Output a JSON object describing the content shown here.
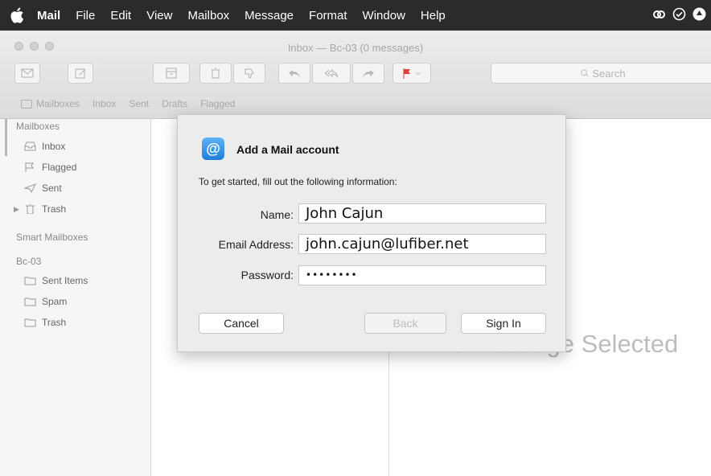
{
  "menubar": {
    "items": [
      "Mail",
      "File",
      "Edit",
      "View",
      "Mailbox",
      "Message",
      "Format",
      "Window",
      "Help"
    ]
  },
  "window": {
    "title": "Inbox — Bc-03 (0 messages)",
    "search_placeholder": "Search"
  },
  "favorites": {
    "mailboxes_label": "Mailboxes",
    "items": [
      "Inbox",
      "Sent",
      "Drafts",
      "Flagged"
    ]
  },
  "sidebar": {
    "mailboxes_header": "Mailboxes",
    "mailboxes": [
      "Inbox",
      "Flagged",
      "Sent",
      "Trash"
    ],
    "smart_header": "Smart Mailboxes",
    "account_header": "Bc-03",
    "account_items": [
      "Sent Items",
      "Spam",
      "Trash"
    ]
  },
  "viewer": {
    "empty_text": "No Message Selected"
  },
  "dialog": {
    "title": "Add a Mail account",
    "subtitle": "To get started, fill out the following information:",
    "name_label": "Name:",
    "name_value": "John Cajun",
    "email_label": "Email Address:",
    "email_value": "john.cajun@lufiber.net",
    "password_label": "Password:",
    "password_value": "••••••••",
    "cancel_label": "Cancel",
    "back_label": "Back",
    "signin_label": "Sign In"
  },
  "colors": {
    "menubar_bg": "#2b2b2b",
    "dialog_bg": "#ececec",
    "icon_blue": "#1f7fd8",
    "flag_red": "#e0403a"
  }
}
